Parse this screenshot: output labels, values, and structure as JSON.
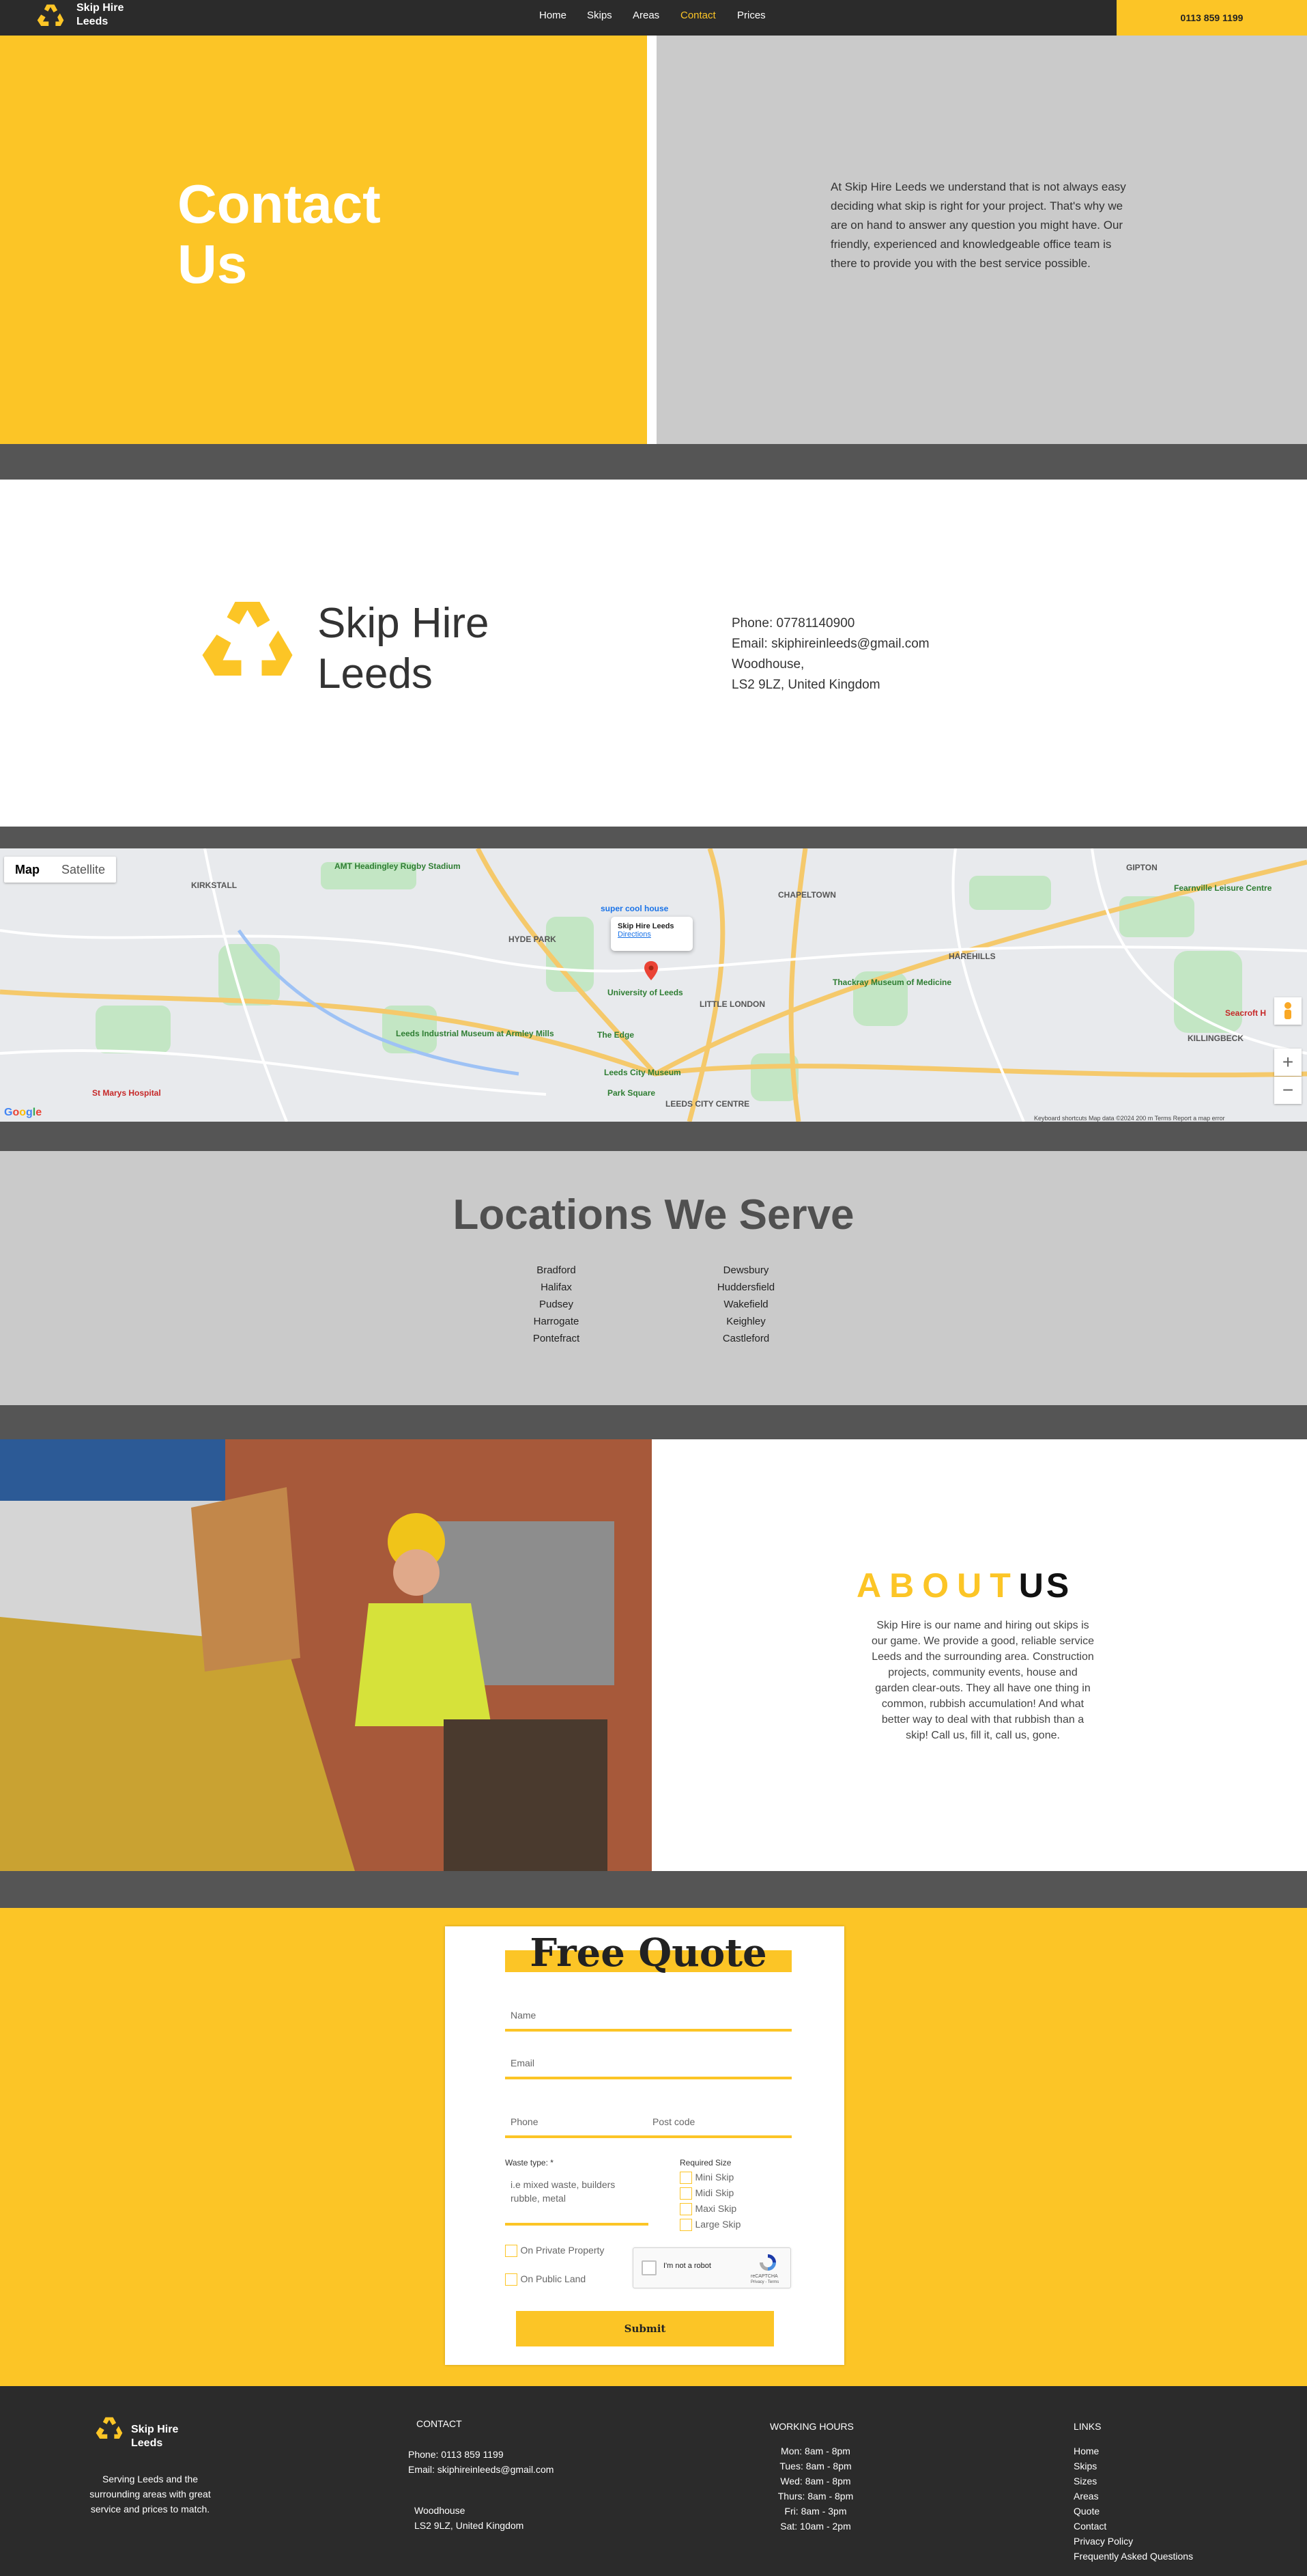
{
  "header": {
    "logo_line1": "Skip Hire",
    "logo_line2": "Leeds",
    "nav": [
      "Home",
      "Skips",
      "Areas",
      "Contact",
      "Prices"
    ],
    "phone": "0113 859 1199"
  },
  "hero": {
    "title_line1": "Contact",
    "title_line2": "Us",
    "text": "At Skip Hire Leeds we understand that is not always easy deciding what skip is right for your project. That's why we are on hand to answer any question you might have. Our friendly, experienced and knowledgeable office team is there to provide you with the best service possible."
  },
  "company": {
    "name_line1": "Skip Hire",
    "name_line2": "Leeds",
    "phone": "Phone: 07781140900",
    "email": "Email: skiphireinleeds@gmail.com",
    "address1": "Woodhouse,",
    "address2": "LS2 9LZ, United Kingdom"
  },
  "map": {
    "type_map": "Map",
    "type_satellite": "Satellite",
    "popup_title": "Skip Hire Leeds",
    "popup_link": "Directions",
    "zoom_in": "+",
    "zoom_out": "−",
    "google": "Google",
    "footer_text": "Keyboard shortcuts   Map data ©2024   200 m   Terms   Report a map error",
    "labels": [
      "AMT Headingley Rugby Stadium",
      "KIRKSTALL",
      "HYDE PARK",
      "CHAPELTOWN",
      "GIPTON",
      "HAREHILLS",
      "University of Leeds",
      "LITTLE LONDON",
      "Thackray Museum of Medicine",
      "Leeds Industrial Museum at Armley Mills",
      "The Edge",
      "Leeds City Museum",
      "Park Square",
      "LEEDS CITY CENTRE",
      "St Marys Hospital",
      "KILLINGBECK",
      "Fearnville Leisure Centre",
      "Seacroft H",
      "super cool house"
    ]
  },
  "locations": {
    "title": "Locations We Serve",
    "col1": [
      "Bradford",
      "Halifax",
      "Pudsey",
      "Harrogate",
      "Pontefract"
    ],
    "col2": [
      "Dewsbury",
      "Huddersfield",
      "Wakefield",
      "Keighley",
      "Castleford"
    ]
  },
  "about": {
    "head_yellow": "ABOUT",
    "head_black": "US",
    "text": "Skip Hire is our name and hiring out skips is our game. We provide a good, reliable service Leeds and the surrounding area. Construction projects, community events, house and garden clear-outs. They all have one thing in common, rubbish accumulation! And what better way to deal with that rubbish than a skip! Call us, fill it, call us, gone."
  },
  "quote": {
    "title": "Free Quote",
    "name_placeholder": "Name",
    "email_placeholder": "Email",
    "phone_placeholder": "Phone",
    "postcode_placeholder": "Post code",
    "waste_label": "Waste type: *",
    "waste_placeholder": "i.e mixed waste, builders rubble, metal",
    "size_label": "Required Size",
    "sizes": [
      "Mini Skip",
      "Midi Skip",
      "Maxi Skip",
      "Large Skip"
    ],
    "private": "On Private Property",
    "public": "On Public Land",
    "captcha": "I'm not a robot",
    "captcha_brand": "reCAPTCHA",
    "captcha_links": "Privacy - Terms",
    "submit": "Submit"
  },
  "footer": {
    "logo_line1": "Skip Hire",
    "logo_line2": "Leeds",
    "blurb": "Serving Leeds and the surrounding areas with great service and prices to match.",
    "contact_head": "CONTACT",
    "contact_phone": "Phone: 0113 859 1199",
    "contact_email": "Email: skiphireinleeds@gmail.com",
    "addr1": "Woodhouse",
    "addr2": "LS2 9LZ, United Kingdom",
    "hours_head": "WORKING HOURS",
    "hours": [
      "Mon: 8am - 8pm",
      "Tues: 8am - 8pm",
      "Wed: 8am - 8pm",
      "Thurs: 8am - 8pm",
      "Fri: 8am - 3pm",
      "Sat: 10am - 2pm"
    ],
    "links_head": "LINKS",
    "links": [
      "Home",
      "Skips",
      "Sizes",
      "Areas",
      "Quote",
      "Contact",
      "Privacy Policy",
      "Frequently Asked Questions"
    ]
  },
  "colors": {
    "accent": "#fcc526",
    "dark": "#2b2b2b",
    "gray": "#cacaca",
    "band": "#555555"
  }
}
